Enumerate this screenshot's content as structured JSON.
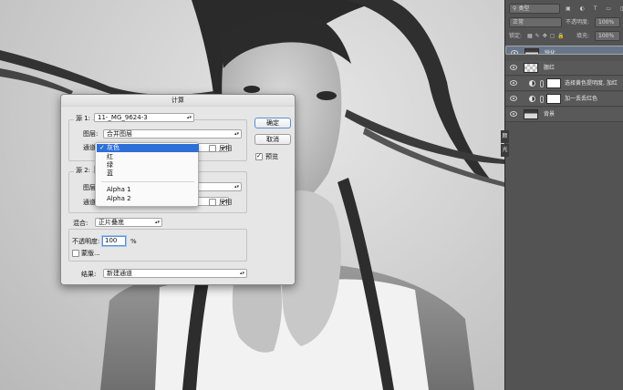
{
  "dialog": {
    "title": "计算",
    "source1": {
      "label": "源 1:",
      "file": "11-_MG_9624-3"
    },
    "layer_label": "图层:",
    "layer_value": "合并图层",
    "channel_label": "通道:",
    "channel_value": "灰色",
    "invert_label": "反相",
    "source2": {
      "label": "源 2:"
    },
    "blending": {
      "label": "混合:",
      "value": "正片叠底"
    },
    "opacity": {
      "label": "不透明度:",
      "value": "100",
      "unit": "%"
    },
    "mask_label": "蒙版...",
    "result": {
      "label": "结果:",
      "value": "新建通道"
    },
    "ok_label": "确定",
    "cancel_label": "取消",
    "preview_label": "预览",
    "preview_checked": true
  },
  "channel_menu": {
    "items": [
      "灰色",
      "红",
      "绿",
      "蓝",
      "Alpha 1",
      "Alpha 2"
    ],
    "selected": "灰色",
    "checkmark": "✓"
  },
  "layers_panel": {
    "filter_kind": "类型",
    "blend_mode": "正常",
    "opacity_label": "不透明度:",
    "opacity_value": "100%",
    "lock_label": "锁定:",
    "fill_label": "填充:",
    "fill_value": "100%",
    "layers": [
      {
        "name": "锐化",
        "selected": true,
        "type": "pixel"
      },
      {
        "name": "腮红",
        "selected": false,
        "type": "empty"
      },
      {
        "name": "选择黄色提明度, 加红",
        "selected": false,
        "type": "adjustment"
      },
      {
        "name": "加一丢丢红色",
        "selected": false,
        "type": "adjustment"
      },
      {
        "name": "背景",
        "selected": false,
        "type": "pixel"
      }
    ],
    "side_tabs": [
      "颜",
      "光"
    ]
  },
  "colors": {
    "menu_highlight": "#2f6fd8",
    "selected_layer": "#68768b",
    "panel_bg": "#535353"
  }
}
